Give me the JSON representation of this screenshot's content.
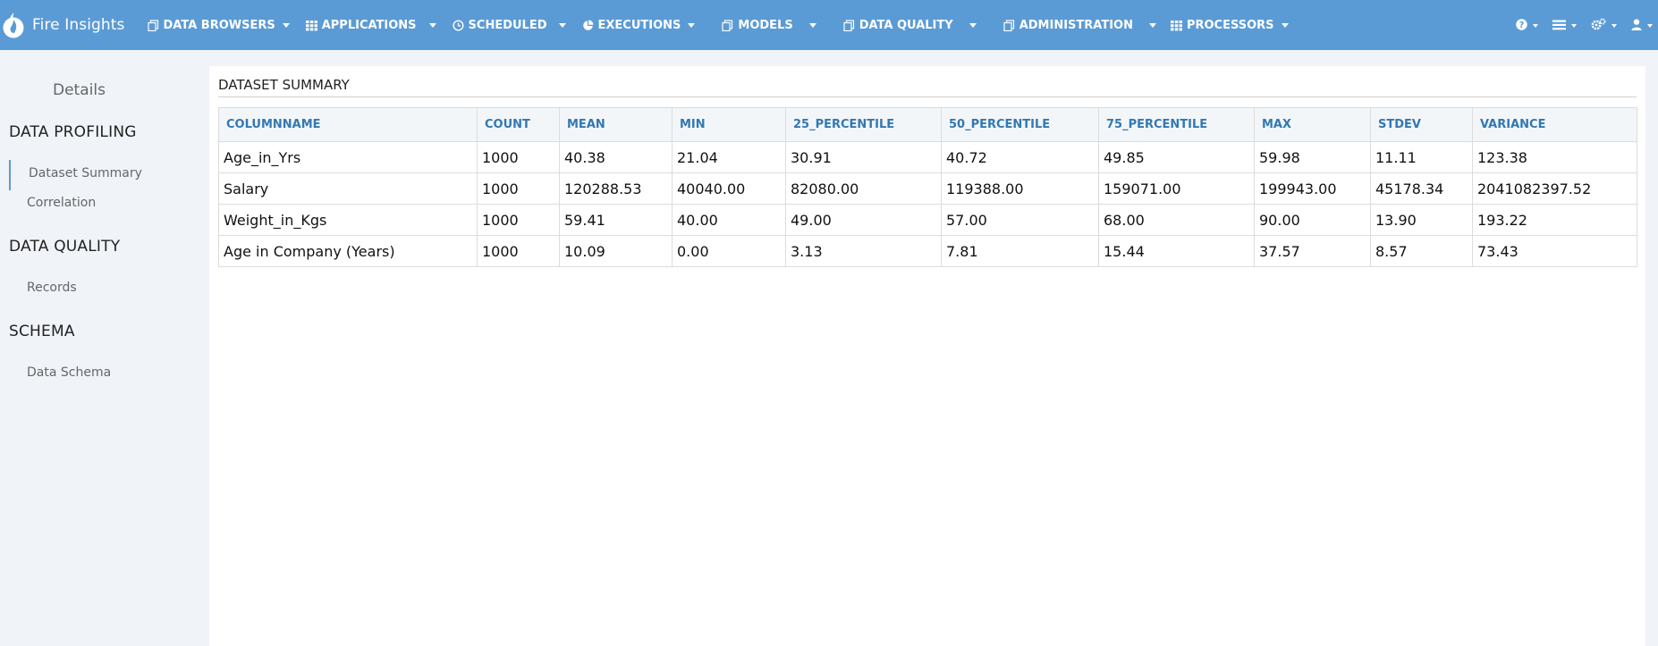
{
  "app": {
    "name": "Fire Insights"
  },
  "nav": {
    "items": [
      {
        "label": "DATA BROWSERS",
        "icon": "copy-icon"
      },
      {
        "label": "APPLICATIONS",
        "icon": "grid-icon"
      },
      {
        "label": "SCHEDULED",
        "icon": "clock-icon"
      },
      {
        "label": "EXECUTIONS",
        "icon": "pie-chart-icon"
      },
      {
        "label": "MODELS",
        "icon": "copy-icon"
      },
      {
        "label": "DATA QUALITY",
        "icon": "copy-icon"
      },
      {
        "label": "ADMINISTRATION",
        "icon": "copy-icon"
      },
      {
        "label": "PROCESSORS",
        "icon": "grid-icon"
      }
    ],
    "right_icons": [
      "help-icon",
      "list-icon",
      "cogs-icon",
      "user-icon"
    ]
  },
  "sidebar": {
    "title": "Details",
    "sections": [
      {
        "label": "DATA PROFILING",
        "items": [
          "Dataset Summary",
          "Correlation"
        ]
      },
      {
        "label": "DATA QUALITY",
        "items": [
          "Records"
        ]
      },
      {
        "label": "SCHEMA",
        "items": [
          "Data Schema"
        ]
      }
    ],
    "active_item": "Dataset Summary"
  },
  "main": {
    "title": "DATASET SUMMARY",
    "table": {
      "headers": [
        "COLUMNNAME",
        "COUNT",
        "MEAN",
        "MIN",
        "25_PERCENTILE",
        "50_PERCENTILE",
        "75_PERCENTILE",
        "MAX",
        "STDEV",
        "VARIANCE"
      ],
      "rows": [
        [
          "Age_in_Yrs",
          "1000",
          "40.38",
          "21.04",
          "30.91",
          "40.72",
          "49.85",
          "59.98",
          "11.11",
          "123.38"
        ],
        [
          "Salary",
          "1000",
          "120288.53",
          "40040.00",
          "82080.00",
          "119388.00",
          "159071.00",
          "199943.00",
          "45178.34",
          "2041082397.52"
        ],
        [
          "Weight_in_Kgs",
          "1000",
          "59.41",
          "40.00",
          "49.00",
          "57.00",
          "68.00",
          "90.00",
          "13.90",
          "193.22"
        ],
        [
          "Age in Company (Years)",
          "1000",
          "10.09",
          "0.00",
          "3.13",
          "7.81",
          "15.44",
          "37.57",
          "8.57",
          "73.43"
        ]
      ]
    }
  },
  "colors": {
    "topbar": "#5b9bd5",
    "header_text": "#3278b4",
    "page_bg": "#f0f3f8"
  }
}
